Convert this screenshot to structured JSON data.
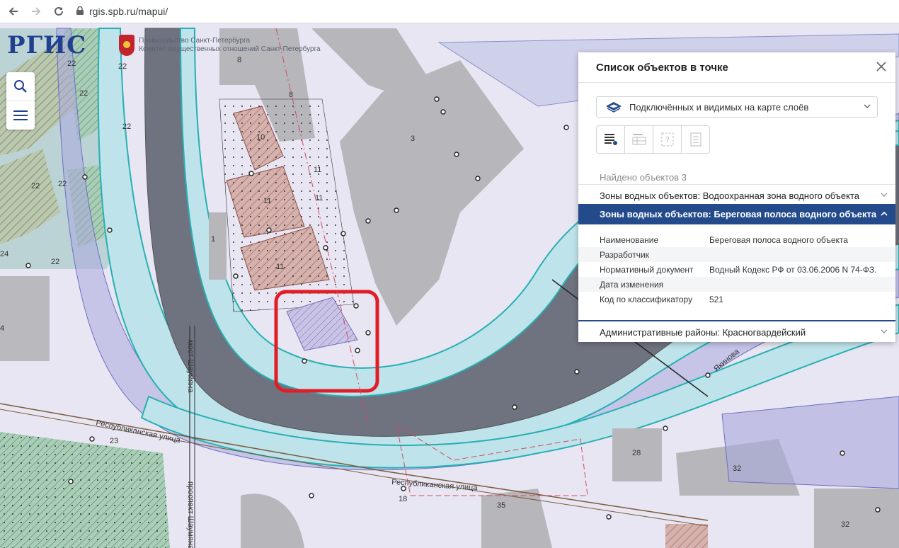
{
  "browser": {
    "url": "rgis.spb.ru/mapui/"
  },
  "logo": {
    "text": "РГИС",
    "org_line1": "Правительство Санкт-Петербурга",
    "org_line2": "Комитет имущественных отношений Санкт-Петербурга"
  },
  "map": {
    "labels": {
      "l8a": "8",
      "l8b": "8",
      "l10": "10",
      "l3": "3",
      "l11a": "11",
      "l11b": "11",
      "l11c": "11",
      "l11d": "11",
      "l1": "1",
      "l22a": "22",
      "l22b": "22",
      "l22c": "22",
      "l22d": "22",
      "l22e": "22",
      "l22f": "22",
      "l22g": "22",
      "l24": "24",
      "l4": "4",
      "l23": "23",
      "l18": "18",
      "l35": "35",
      "l28": "28",
      "l32a": "32",
      "l32b": "32",
      "street1": "Республиканская улица",
      "street2": "Республиканская улица",
      "bridge": "мост Шаумяна",
      "avenue": "проспект Шаумяна",
      "street3": "Якинова"
    }
  },
  "panel": {
    "title": "Список объектов в точке",
    "layer_select": "Подключённых и видимых на карте слоёв",
    "found": "Найдено объектов 3",
    "accordion": [
      "Зоны водных объектов: Водоохранная зона водного объекта",
      "Зоны водных объектов: Береговая полоса водного объекта",
      "Административные районы: Красногвардейский"
    ],
    "details": [
      {
        "key": "Наименование",
        "value": "Береговая полоса водного объекта"
      },
      {
        "key": "Разработчик",
        "value": ""
      },
      {
        "key": "Нормативный документ",
        "value": "Водный Кодекс РФ от 03.06.2006 N 74-ФЗ."
      },
      {
        "key": "Дата изменения",
        "value": ""
      },
      {
        "key": "Код по классификатору",
        "value": "521"
      }
    ]
  },
  "colors": {
    "accent": "#234b8c",
    "water_zone": "#bfe3ea",
    "river": "#6f7380",
    "highlight": "#e11d26"
  }
}
